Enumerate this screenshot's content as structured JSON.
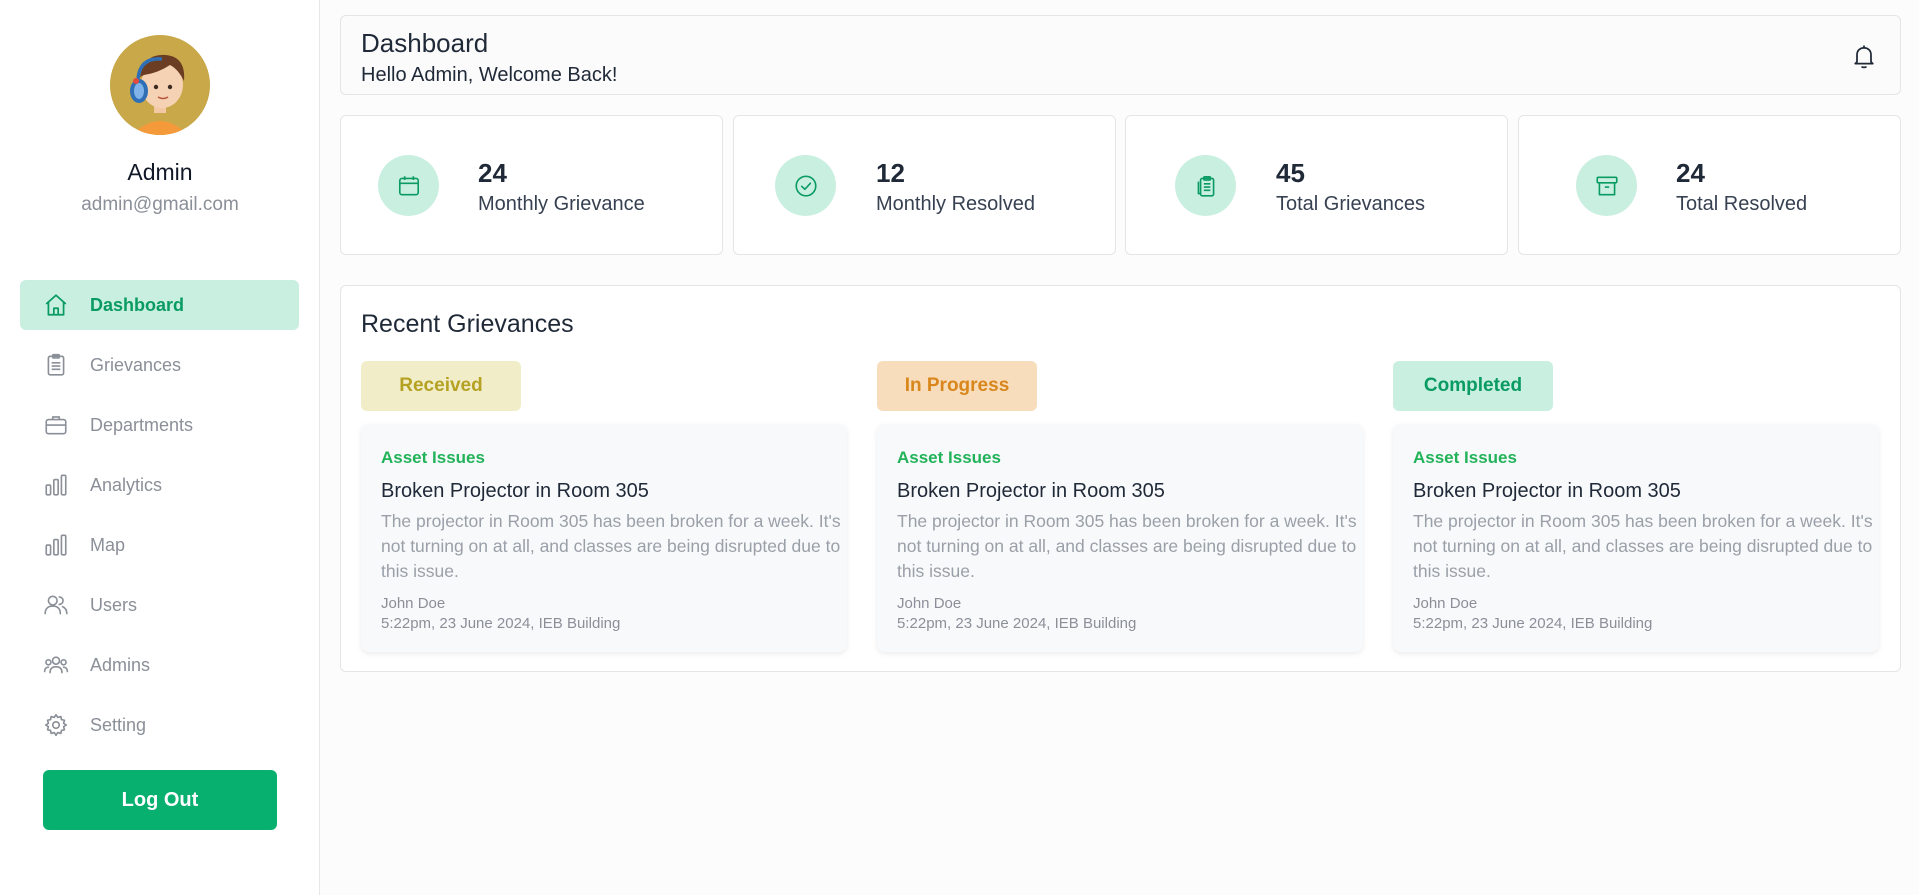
{
  "colors": {
    "accent": "#08b06f",
    "accent_light": "#c9efe1",
    "received_bg": "#f1edc8",
    "received_text": "#b5a224",
    "progress_bg": "#f7ddbb",
    "progress_text": "#d9861c",
    "completed_bg": "#c9efe1",
    "completed_text": "#0a9b63"
  },
  "profile": {
    "name": "Admin",
    "email": "admin@gmail.com",
    "avatar_icon": "avatar-illustration"
  },
  "sidebar": {
    "items": [
      {
        "label": "Dashboard",
        "icon": "home-icon",
        "active": true
      },
      {
        "label": "Grievances",
        "icon": "clipboard-icon",
        "active": false
      },
      {
        "label": "Departments",
        "icon": "briefcase-icon",
        "active": false
      },
      {
        "label": "Analytics",
        "icon": "bar-chart-icon",
        "active": false
      },
      {
        "label": "Map",
        "icon": "bar-chart-icon",
        "active": false
      },
      {
        "label": "Users",
        "icon": "users-icon",
        "active": false
      },
      {
        "label": "Admins",
        "icon": "admins-icon",
        "active": false
      },
      {
        "label": "Setting",
        "icon": "gear-icon",
        "active": false
      }
    ],
    "logout_label": "Log Out"
  },
  "header": {
    "title": "Dashboard",
    "subtitle": "Hello Admin, Welcome Back!",
    "bell_icon": "bell-icon"
  },
  "stats": [
    {
      "value": "24",
      "label": "Monthly Grievance",
      "icon": "calendar-icon"
    },
    {
      "value": "12",
      "label": "Monthly Resolved",
      "icon": "check-circle-icon"
    },
    {
      "value": "45",
      "label": "Total Grievances",
      "icon": "clipboards-icon"
    },
    {
      "value": "24",
      "label": "Total Resolved",
      "icon": "archive-icon"
    }
  ],
  "recent": {
    "title": "Recent Grievances",
    "columns": [
      {
        "status": "Received",
        "card": {
          "category": "Asset Issues",
          "title": "Broken Projector in Room 305",
          "description": "The projector in Room 305 has been broken for a week. It's not turning on at all, and classes are being disrupted due to this issue.",
          "author": "John Doe",
          "meta": "5:22pm, 23 June 2024, IEB Building"
        }
      },
      {
        "status": "In Progress",
        "card": {
          "category": "Asset Issues",
          "title": "Broken Projector in Room 305",
          "description": "The projector in Room 305 has been broken for a week. It's not turning on at all, and classes are being disrupted due to this issue.",
          "author": "John Doe",
          "meta": "5:22pm, 23 June 2024, IEB Building"
        }
      },
      {
        "status": "Completed",
        "card": {
          "category": "Asset Issues",
          "title": "Broken Projector in Room 305",
          "description": "The projector in Room 305 has been broken for a week. It's not turning on at all, and classes are being disrupted due to this issue.",
          "author": "John Doe",
          "meta": "5:22pm, 23 June 2024, IEB Building"
        }
      }
    ]
  }
}
